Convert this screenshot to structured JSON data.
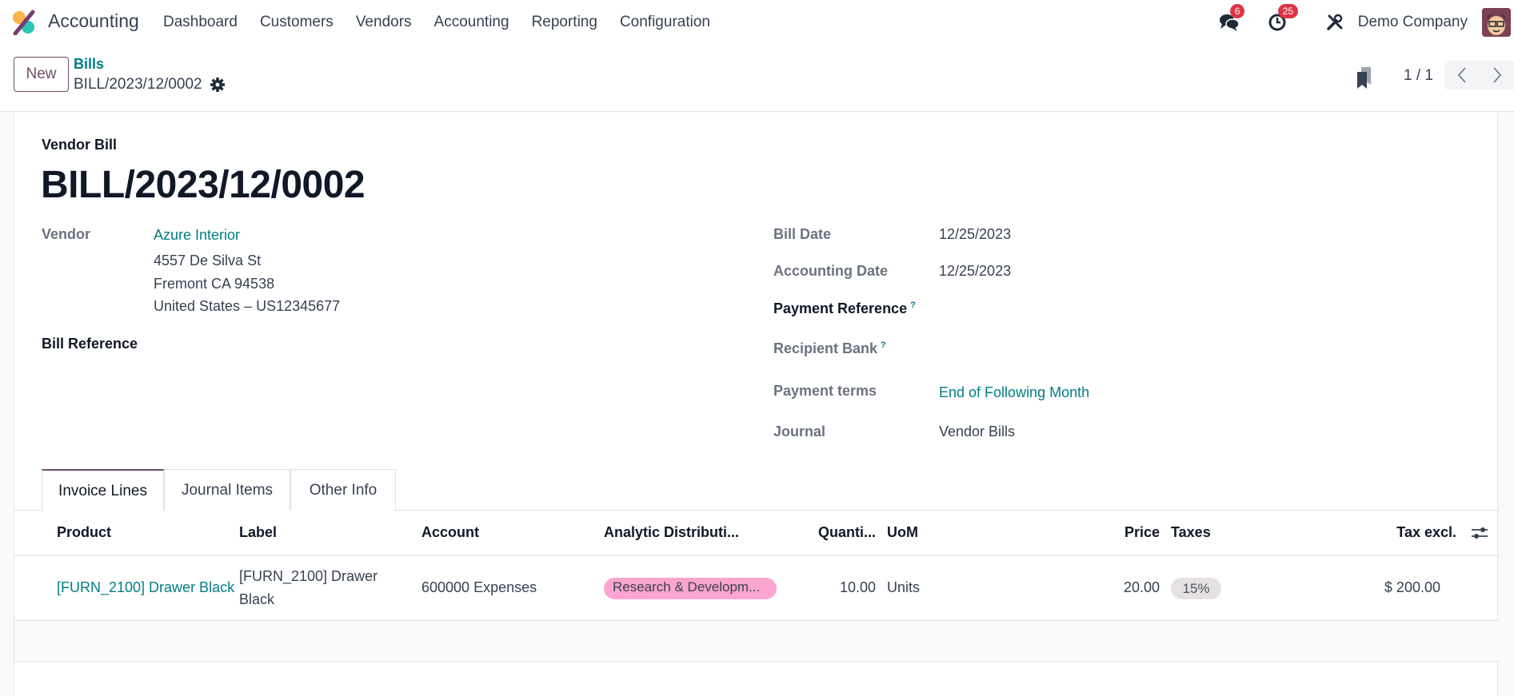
{
  "navbar": {
    "app_name": "Accounting",
    "menu": [
      "Dashboard",
      "Customers",
      "Vendors",
      "Accounting",
      "Reporting",
      "Configuration"
    ],
    "messages_count": "6",
    "activities_count": "25",
    "company": "Demo Company",
    "icons": [
      "app-logo",
      "chat-icon",
      "clock-icon",
      "tools-icon",
      "avatar"
    ]
  },
  "control_panel": {
    "new_label": "New",
    "breadcrumb_parent": "Bills",
    "breadcrumb_current": "BILL/2023/12/0002",
    "pager": "1 / 1"
  },
  "form": {
    "doc_type": "Vendor Bill",
    "title": "BILL/2023/12/0002",
    "vendor_label": "Vendor",
    "vendor_name": "Azure Interior",
    "vendor_address": [
      "4557 De Silva St",
      "Fremont CA 94538",
      "United States – US12345677"
    ],
    "bill_reference_label": "Bill Reference",
    "bill_date_label": "Bill Date",
    "bill_date": "12/25/2023",
    "accounting_date_label": "Accounting Date",
    "accounting_date": "12/25/2023",
    "payment_reference_label": "Payment Reference",
    "recipient_bank_label": "Recipient Bank",
    "help_mark": "?",
    "payment_terms_label": "Payment terms",
    "payment_terms": "End of Following Month",
    "journal_label": "Journal",
    "journal": "Vendor Bills"
  },
  "tabs": [
    {
      "label": "Invoice Lines",
      "active": true
    },
    {
      "label": "Journal Items",
      "active": false
    },
    {
      "label": "Other Info",
      "active": false
    }
  ],
  "table": {
    "columns": [
      "Product",
      "Label",
      "Account",
      "Analytic Distributi...",
      "Quanti...",
      "UoM",
      "Price",
      "Taxes",
      "Tax excl."
    ],
    "rows": [
      {
        "product": "[FURN_2100] Drawer Black",
        "label_line1": "[FURN_2100] Drawer",
        "label_line2": "Black",
        "account": "600000 Expenses",
        "analytic": "Research & Developm...",
        "quantity": "10.00",
        "uom": "Units",
        "price": "20.00",
        "taxes": "15%",
        "tax_excl": "$ 200.00"
      }
    ]
  },
  "colors": {
    "brand": "#714b67",
    "link": "#017e84",
    "badge": "#dc3545",
    "analytic_tag": "#fca5d0",
    "tax_tag": "#e7e2e2"
  }
}
